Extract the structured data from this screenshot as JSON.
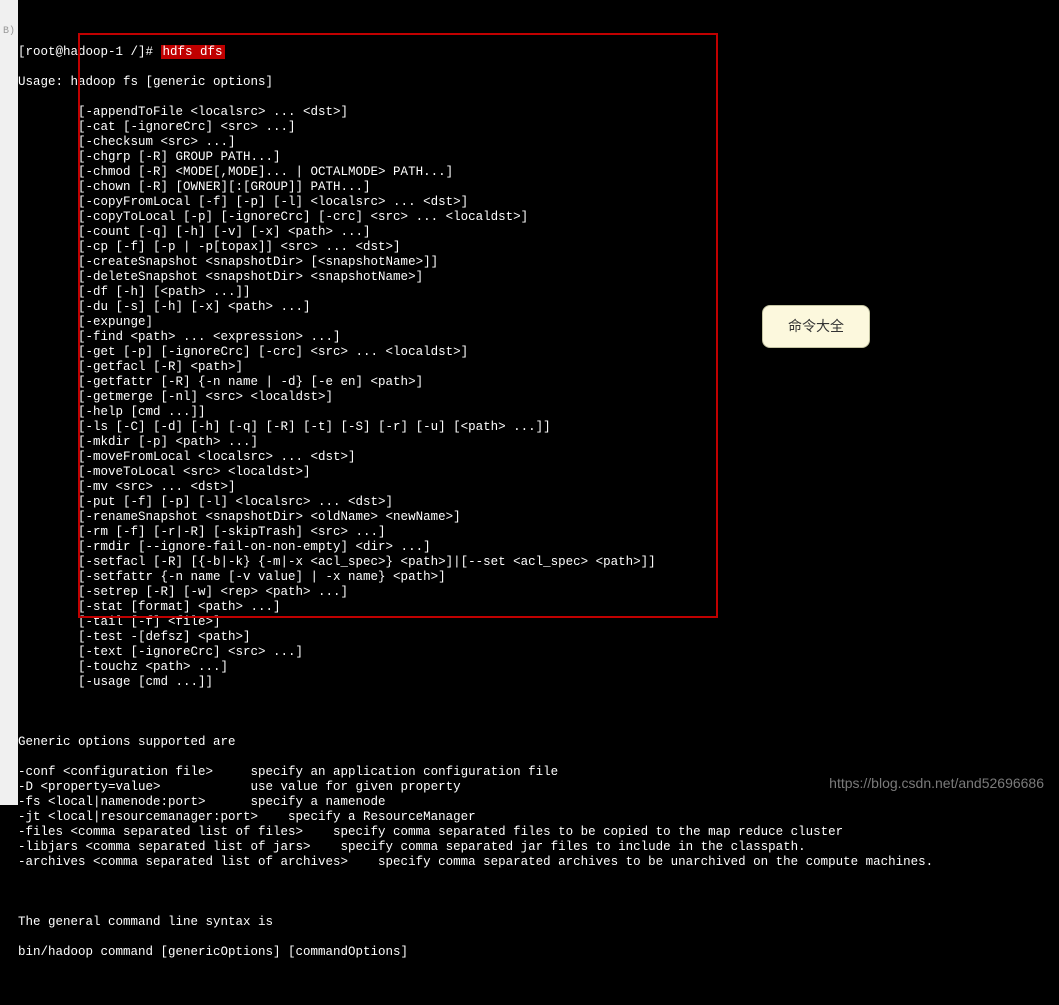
{
  "left_margin_label": "B)",
  "prompt_prefix": "[root@hadoop-1 /]#",
  "command": "hdfs dfs",
  "usage_line": "Usage: hadoop fs [generic options]",
  "cmds": [
    "[-appendToFile <localsrc> ... <dst>]",
    "[-cat [-ignoreCrc] <src> ...]",
    "[-checksum <src> ...]",
    "[-chgrp [-R] GROUP PATH...]",
    "[-chmod [-R] <MODE[,MODE]... | OCTALMODE> PATH...]",
    "[-chown [-R] [OWNER][:[GROUP]] PATH...]",
    "[-copyFromLocal [-f] [-p] [-l] <localsrc> ... <dst>]",
    "[-copyToLocal [-p] [-ignoreCrc] [-crc] <src> ... <localdst>]",
    "[-count [-q] [-h] [-v] [-x] <path> ...]",
    "[-cp [-f] [-p | -p[topax]] <src> ... <dst>]",
    "[-createSnapshot <snapshotDir> [<snapshotName>]]",
    "[-deleteSnapshot <snapshotDir> <snapshotName>]",
    "[-df [-h] [<path> ...]]",
    "[-du [-s] [-h] [-x] <path> ...]",
    "[-expunge]",
    "[-find <path> ... <expression> ...]",
    "[-get [-p] [-ignoreCrc] [-crc] <src> ... <localdst>]",
    "[-getfacl [-R] <path>]",
    "[-getfattr [-R] {-n name | -d} [-e en] <path>]",
    "[-getmerge [-nl] <src> <localdst>]",
    "[-help [cmd ...]]",
    "[-ls [-C] [-d] [-h] [-q] [-R] [-t] [-S] [-r] [-u] [<path> ...]]",
    "[-mkdir [-p] <path> ...]",
    "[-moveFromLocal <localsrc> ... <dst>]",
    "[-moveToLocal <src> <localdst>]",
    "[-mv <src> ... <dst>]",
    "[-put [-f] [-p] [-l] <localsrc> ... <dst>]",
    "[-renameSnapshot <snapshotDir> <oldName> <newName>]",
    "[-rm [-f] [-r|-R] [-skipTrash] <src> ...]",
    "[-rmdir [--ignore-fail-on-non-empty] <dir> ...]",
    "[-setfacl [-R] [{-b|-k} {-m|-x <acl_spec>} <path>]|[--set <acl_spec> <path>]]",
    "[-setfattr {-n name [-v value] | -x name} <path>]",
    "[-setrep [-R] [-w] <rep> <path> ...]",
    "[-stat [format] <path> ...]",
    "[-tail [-f] <file>]",
    "[-test -[defsz] <path>]",
    "[-text [-ignoreCrc] <src> ...]",
    "[-touchz <path> ...]",
    "[-usage [cmd ...]]"
  ],
  "generic_header": "Generic options supported are",
  "generic_options": [
    "-conf <configuration file>     specify an application configuration file",
    "-D <property=value>            use value for given property",
    "-fs <local|namenode:port>      specify a namenode",
    "-jt <local|resourcemanager:port>    specify a ResourceManager",
    "-files <comma separated list of files>    specify comma separated files to be copied to the map reduce cluster",
    "-libjars <comma separated list of jars>    specify comma separated jar files to include in the classpath.",
    "-archives <comma separated list of archives>    specify comma separated archives to be unarchived on the compute machines."
  ],
  "syntax_header": "The general command line syntax is",
  "syntax_line": "bin/hadoop command [genericOptions] [commandOptions]",
  "callout_text": "命令大全",
  "watermark_text": "https://blog.csdn.net/and52696686"
}
